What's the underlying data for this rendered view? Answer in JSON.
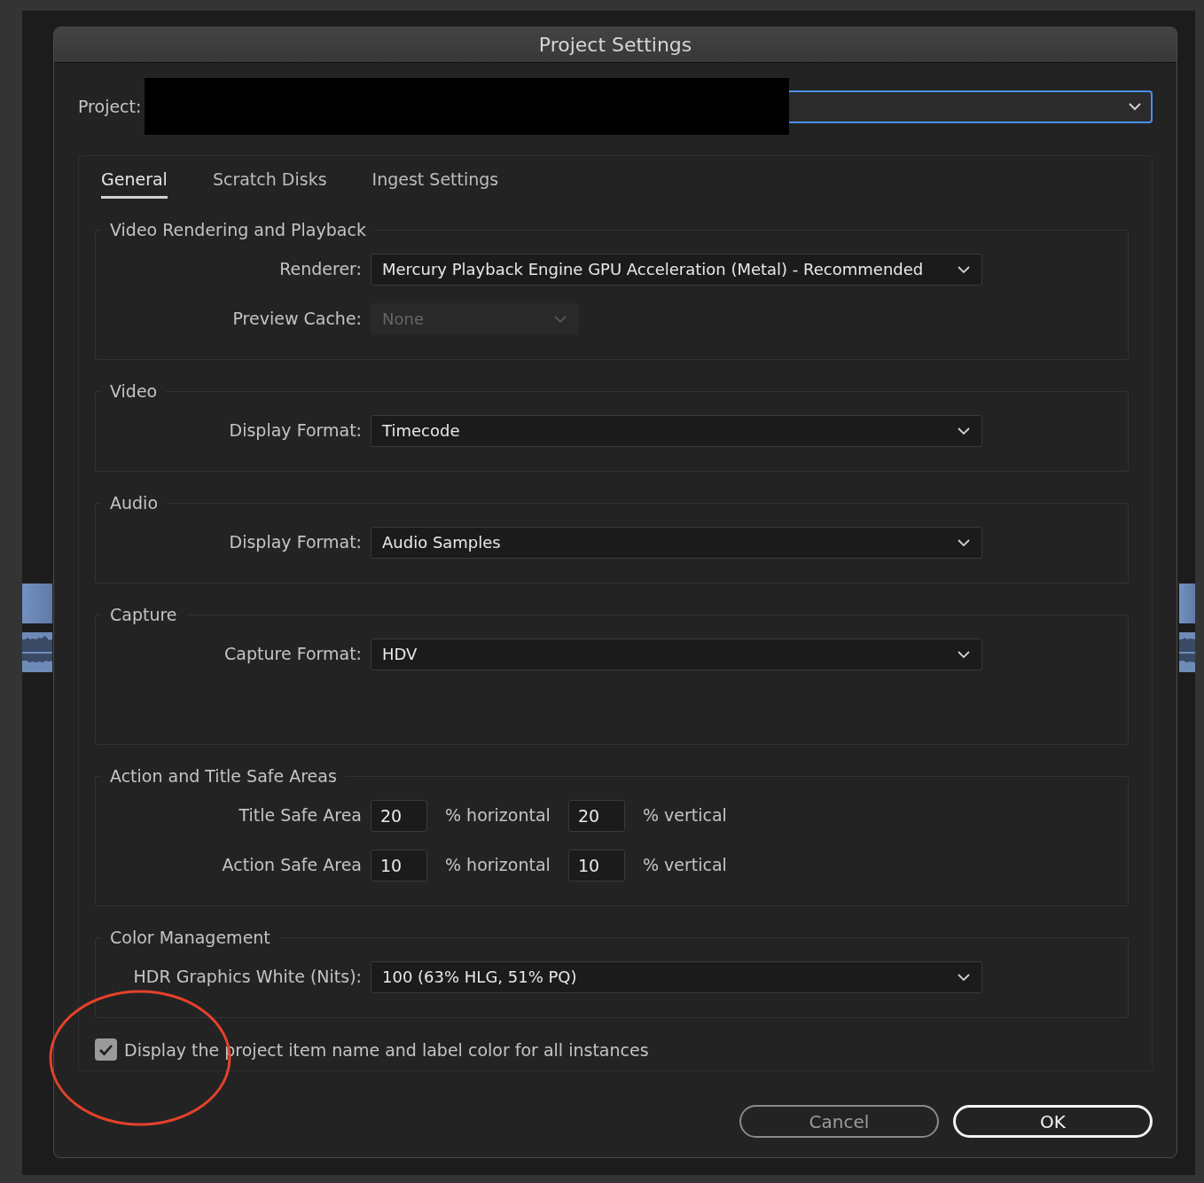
{
  "window": {
    "title": "Project Settings"
  },
  "project": {
    "label": "Project:"
  },
  "tabs": [
    {
      "label": "General",
      "selected": true
    },
    {
      "label": "Scratch Disks",
      "selected": false
    },
    {
      "label": "Ingest Settings",
      "selected": false
    }
  ],
  "groups": [
    {
      "title": "Video Rendering and Playback",
      "rows": [
        {
          "kind": "select",
          "label": "Renderer:",
          "value": "Mercury Playback Engine GPU Acceleration (Metal) - Recommended",
          "disabled": false
        },
        {
          "kind": "select",
          "label": "Preview Cache:",
          "value": "None",
          "disabled": true
        }
      ]
    },
    {
      "title": "Video",
      "rows": [
        {
          "kind": "select",
          "label": "Display Format:",
          "value": "Timecode",
          "disabled": false
        }
      ]
    },
    {
      "title": "Audio",
      "rows": [
        {
          "kind": "select",
          "label": "Display Format:",
          "value": "Audio Samples",
          "disabled": false
        }
      ]
    },
    {
      "title": "Capture",
      "rows": [
        {
          "kind": "select",
          "label": "Capture Format:",
          "value": "HDV",
          "disabled": false
        }
      ]
    },
    {
      "title": "Action and Title Safe Areas",
      "rows": [
        {
          "kind": "pair",
          "label": "Title Safe Area",
          "h_value": "20",
          "h_unit": "% horizontal",
          "v_value": "20",
          "v_unit": "% vertical"
        },
        {
          "kind": "pair",
          "label": "Action Safe Area",
          "h_value": "10",
          "h_unit": "% horizontal",
          "v_value": "10",
          "v_unit": "% vertical"
        }
      ]
    },
    {
      "title": "Color Management",
      "rows": [
        {
          "kind": "select",
          "label": "HDR Graphics White (Nits):",
          "value": "100 (63% HLG, 51% PQ)",
          "disabled": false
        }
      ]
    }
  ],
  "checkbox": {
    "label": "Display the project item name and label color for all instances",
    "checked": true
  },
  "buttons": [
    {
      "label": "Cancel",
      "kind": "secondary"
    },
    {
      "label": "OK",
      "kind": "primary"
    }
  ]
}
